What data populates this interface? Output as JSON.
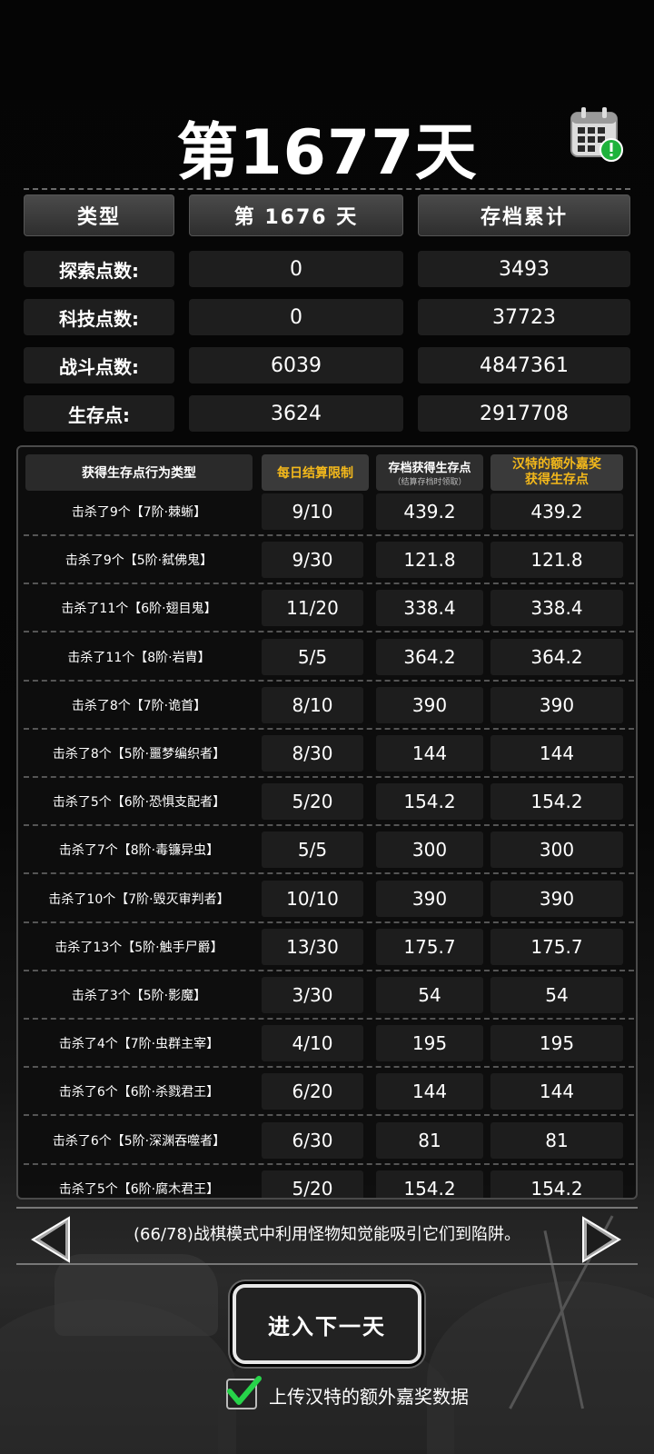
{
  "title": "第1677天",
  "summary": {
    "headers": [
      "类型",
      "第 1676 天",
      "存档累计"
    ],
    "rows": [
      {
        "label": "探索点数:",
        "day": "0",
        "total": "3493"
      },
      {
        "label": "科技点数:",
        "day": "0",
        "total": "37723"
      },
      {
        "label": "战斗点数:",
        "day": "6039",
        "total": "4847361"
      },
      {
        "label": "生存点:",
        "day": "3624",
        "total": "2917708"
      }
    ]
  },
  "table": {
    "headers": {
      "action": "获得生存点行为类型",
      "limit": "每日结算限制",
      "saved": "存档获得生存点",
      "saved_note": "（结算存档时领取）",
      "bonus_line1": "汉特的额外嘉奖",
      "bonus_line2": "获得生存点"
    },
    "rows": [
      {
        "action": "击杀了9个【7阶·棘蜥】",
        "limit": "9/10",
        "saved": "439.2",
        "bonus": "439.2"
      },
      {
        "action": "击杀了9个【5阶·弑佛鬼】",
        "limit": "9/30",
        "saved": "121.8",
        "bonus": "121.8"
      },
      {
        "action": "击杀了11个【6阶·翅目鬼】",
        "limit": "11/20",
        "saved": "338.4",
        "bonus": "338.4"
      },
      {
        "action": "击杀了11个【8阶·岩胄】",
        "limit": "5/5",
        "saved": "364.2",
        "bonus": "364.2"
      },
      {
        "action": "击杀了8个【7阶·诡首】",
        "limit": "8/10",
        "saved": "390",
        "bonus": "390"
      },
      {
        "action": "击杀了8个【5阶·噩梦编织者】",
        "limit": "8/30",
        "saved": "144",
        "bonus": "144"
      },
      {
        "action": "击杀了5个【6阶·恐惧支配者】",
        "limit": "5/20",
        "saved": "154.2",
        "bonus": "154.2"
      },
      {
        "action": "击杀了7个【8阶·毒镰异虫】",
        "limit": "5/5",
        "saved": "300",
        "bonus": "300"
      },
      {
        "action": "击杀了10个【7阶·毁灭审判者】",
        "limit": "10/10",
        "saved": "390",
        "bonus": "390"
      },
      {
        "action": "击杀了13个【5阶·触手尸爵】",
        "limit": "13/30",
        "saved": "175.7",
        "bonus": "175.7"
      },
      {
        "action": "击杀了3个【5阶·影魔】",
        "limit": "3/30",
        "saved": "54",
        "bonus": "54"
      },
      {
        "action": "击杀了4个【7阶·虫群主宰】",
        "limit": "4/10",
        "saved": "195",
        "bonus": "195"
      },
      {
        "action": "击杀了6个【6阶·杀戮君王】",
        "limit": "6/20",
        "saved": "144",
        "bonus": "144"
      },
      {
        "action": "击杀了6个【5阶·深渊吞噬者】",
        "limit": "6/30",
        "saved": "81",
        "bonus": "81"
      },
      {
        "action": "击杀了5个【6阶·腐木君王】",
        "limit": "5/20",
        "saved": "154.2",
        "bonus": "154.2"
      }
    ]
  },
  "tip": "(66/78)战棋模式中利用怪物知觉能吸引它们到陷阱。",
  "next_button": "进入下一天",
  "upload_checkbox": {
    "label": "上传汉特的额外嘉奖数据",
    "checked": true
  },
  "colors": {
    "accent": "#f3b81b",
    "check": "#27d34a"
  },
  "icons": {
    "calendar": "calendar-alert-icon",
    "prev": "triangle-left-icon",
    "next": "triangle-right-icon",
    "check": "check-icon"
  }
}
